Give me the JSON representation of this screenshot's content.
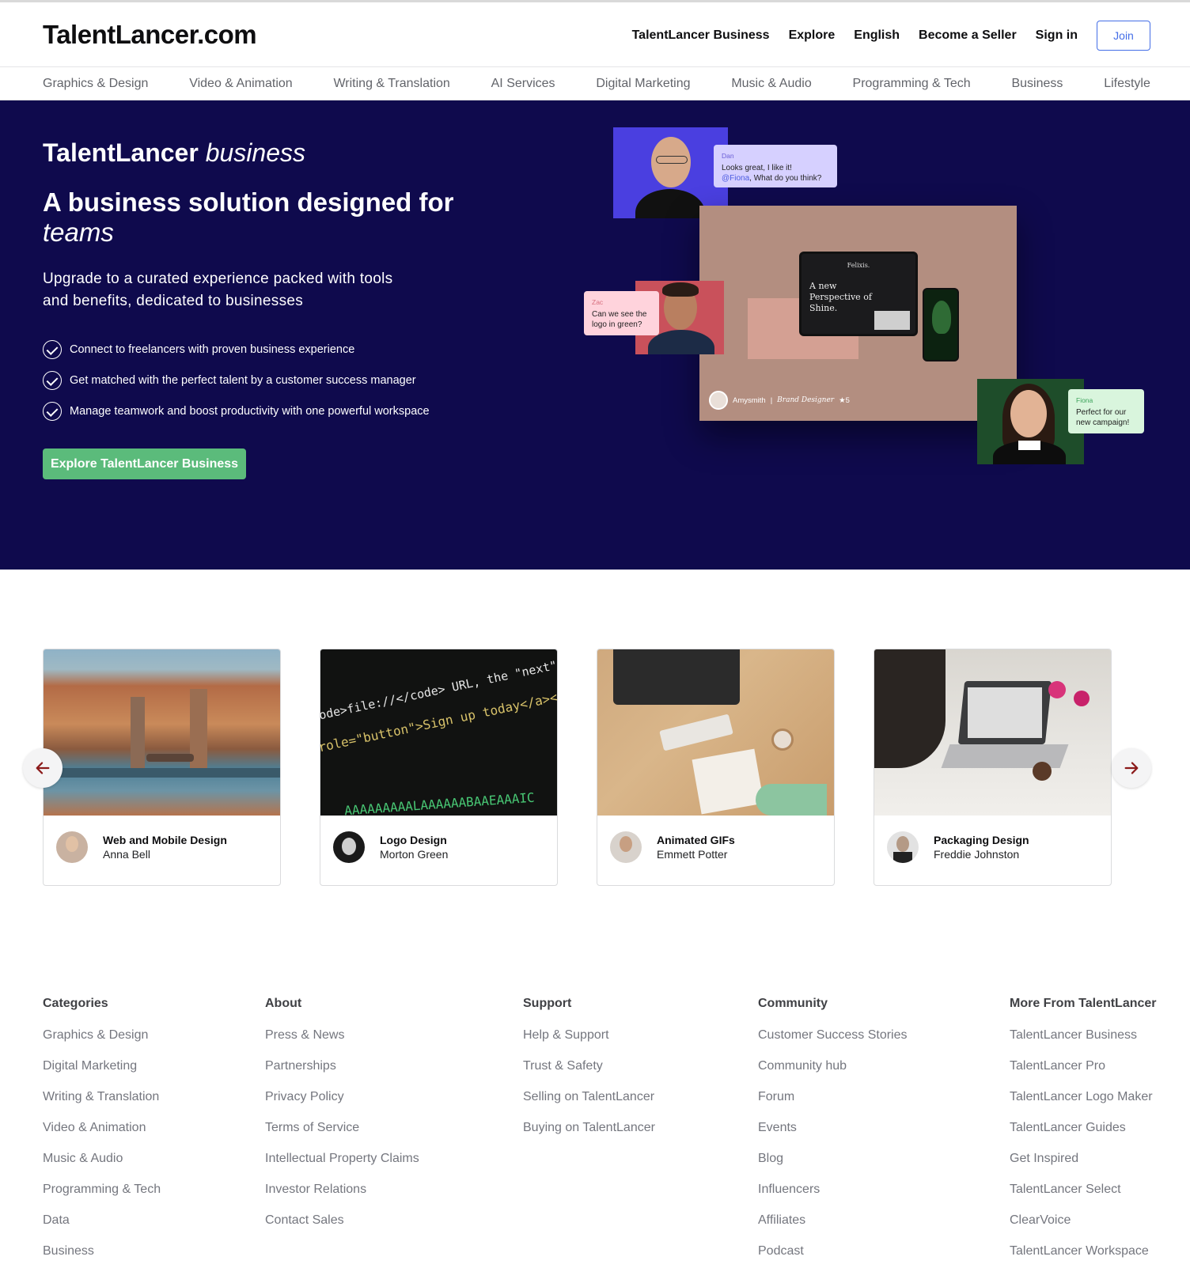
{
  "header": {
    "logo": "TalentLancer.com",
    "nav": {
      "business": "TalentLancer Business",
      "explore": "Explore",
      "language": "English",
      "become_seller": "Become a Seller",
      "sign_in": "Sign in",
      "join": "Join"
    }
  },
  "categories": [
    "Graphics & Design",
    "Video & Animation",
    "Writing & Translation",
    "AI Services",
    "Digital Marketing",
    "Music & Audio",
    "Programming & Tech",
    "Business",
    "Lifestyle"
  ],
  "hero": {
    "brand": "TalentLancer",
    "brand_suffix": "business",
    "title": "A business solution designed for",
    "title_italic": "teams",
    "subtitle": "Upgrade to a curated experience packed with tools and benefits, dedicated to businesses",
    "bullets": [
      "Connect to freelancers with proven business experience",
      "Get matched with the perfect talent by a customer success manager",
      "Manage teamwork and boost productivity with one powerful workspace"
    ],
    "cta": "Explore TalentLancer Business",
    "colors": {
      "background": "#0f0a4d",
      "cta": "#5bbb7b"
    },
    "collage": {
      "dan": {
        "name": "Dan",
        "message": "Looks great, I like it!",
        "mention": "@Fiona",
        "message_tail": ", What do you think?"
      },
      "zac": {
        "name": "Zac",
        "message": "Can we see the logo in green?"
      },
      "fiona": {
        "name": "Fiona",
        "message": "Perfect for our new campaign!"
      },
      "tablet_brand": "Felixis.",
      "tablet_tagline": "A new Perspective of Shine.",
      "designer_name": "Amysmith",
      "designer_role": "Brand Designer",
      "designer_rating": "★5"
    }
  },
  "carousel": {
    "prev_icon": "arrow-left-icon",
    "next_icon": "arrow-right-icon",
    "cards": [
      {
        "title": "Web and Mobile Design",
        "seller": "Anna Bell"
      },
      {
        "title": "Logo Design",
        "seller": "Morton Green"
      },
      {
        "title": "Animated GIFs",
        "seller": "Emmett Potter"
      },
      {
        "title": "Packaging Design",
        "seller": "Freddie Johnston"
      }
    ],
    "code_lines": [
      "code>file://</code> URL, the \"next\"",
      "role=\"button\">Sign up today</a></p>",
      "AAAAAAAAALAAAAAABAAEAAAIC"
    ]
  },
  "footer": {
    "categories": {
      "heading": "Categories",
      "links": [
        "Graphics & Design",
        "Digital Marketing",
        "Writing & Translation",
        "Video & Animation",
        "Music & Audio",
        "Programming & Tech",
        "Data",
        "Business"
      ]
    },
    "about": {
      "heading": "About",
      "links": [
        "Press & News",
        "Partnerships",
        "Privacy Policy",
        "Terms of Service",
        "Intellectual Property Claims",
        "Investor Relations",
        "Contact Sales"
      ]
    },
    "support": {
      "heading": "Support",
      "links": [
        "Help & Support",
        "Trust & Safety",
        "Selling on TalentLancer",
        "Buying on TalentLancer"
      ]
    },
    "community": {
      "heading": "Community",
      "links": [
        "Customer Success Stories",
        "Community hub",
        "Forum",
        "Events",
        "Blog",
        "Influencers",
        "Affiliates",
        "Podcast"
      ]
    },
    "more": {
      "heading": "More From TalentLancer",
      "links": [
        "TalentLancer Business",
        "TalentLancer Pro",
        "TalentLancer Logo Maker",
        "TalentLancer Guides",
        "Get Inspired",
        "TalentLancer Select",
        "ClearVoice",
        "TalentLancer Workspace"
      ]
    }
  }
}
